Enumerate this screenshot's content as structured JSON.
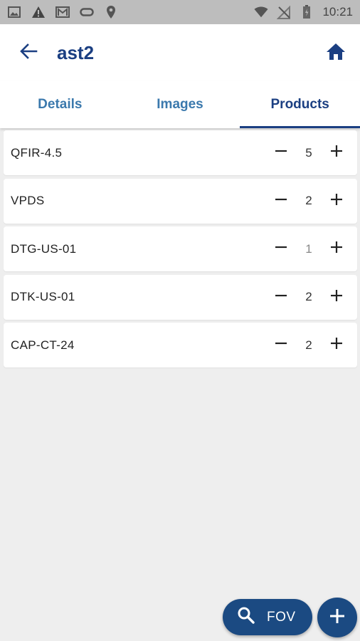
{
  "status_bar": {
    "time": "10:21",
    "icons_left": [
      "image-icon",
      "warning-icon",
      "gmail-icon",
      "voicemail-icon",
      "location-pin-icon"
    ],
    "icons_right": [
      "wifi-icon",
      "no-signal-icon",
      "battery-icon"
    ]
  },
  "app_bar": {
    "title": "ast2",
    "back_icon": "arrow-left-icon",
    "home_icon": "home-icon"
  },
  "tabs": [
    {
      "label": "Details",
      "active": false
    },
    {
      "label": "Images",
      "active": false
    },
    {
      "label": "Products",
      "active": true
    }
  ],
  "products": [
    {
      "name": "QFIR-4.5",
      "quantity": "5"
    },
    {
      "name": "VPDS",
      "quantity": "2"
    },
    {
      "name": "DTG-US-01",
      "quantity": "1"
    },
    {
      "name": "DTK-US-01",
      "quantity": "2"
    },
    {
      "name": "CAP-CT-24",
      "quantity": "2"
    }
  ],
  "fov_button": {
    "label": "FOV",
    "icon": "search-icon"
  },
  "add_button": {
    "icon": "plus-icon"
  },
  "colors": {
    "primary": "#1b3f82",
    "tab_inactive": "#3b79ad",
    "fab": "#1b4a82",
    "background": "#eeeeee"
  }
}
